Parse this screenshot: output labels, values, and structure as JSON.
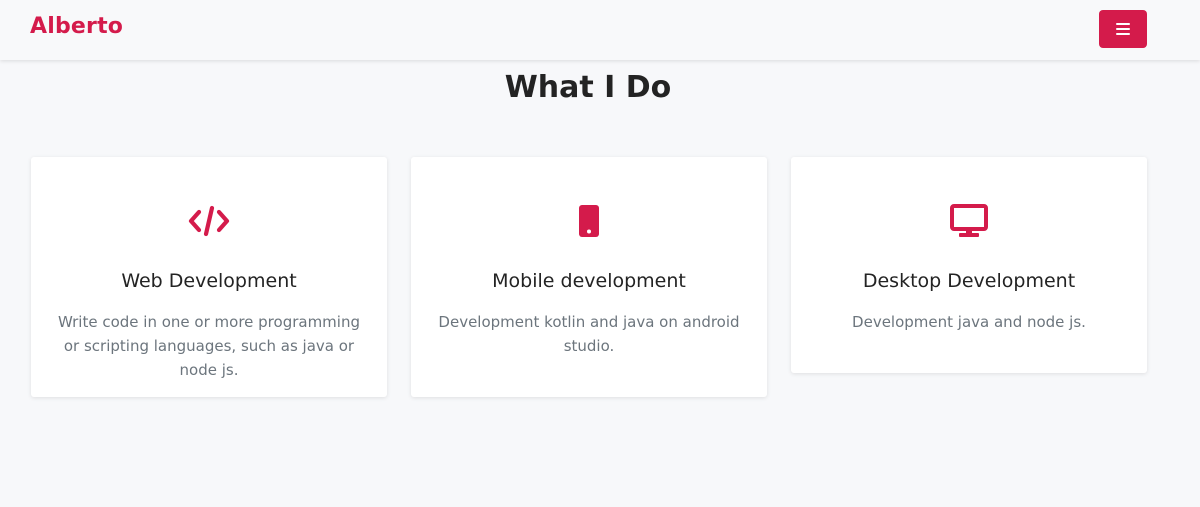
{
  "navbar": {
    "brand": "Alberto",
    "menu_icon": "hamburger-menu-icon"
  },
  "section": {
    "title": "What I Do"
  },
  "services": [
    {
      "icon": "code-icon",
      "title": "Web Development",
      "description": "Write code in one or more programming or scripting languages, such as java or node js."
    },
    {
      "icon": "mobile-phone-icon",
      "title": "Mobile development",
      "description": "Development kotlin and java on android studio."
    },
    {
      "icon": "desktop-monitor-icon",
      "title": "Desktop Development",
      "description": "Development java and node js."
    }
  ],
  "colors": {
    "accent": "#d41b4b",
    "background": "#f7f8fa",
    "card": "#ffffff",
    "heading": "#232323",
    "muted_text": "#6c757d"
  }
}
